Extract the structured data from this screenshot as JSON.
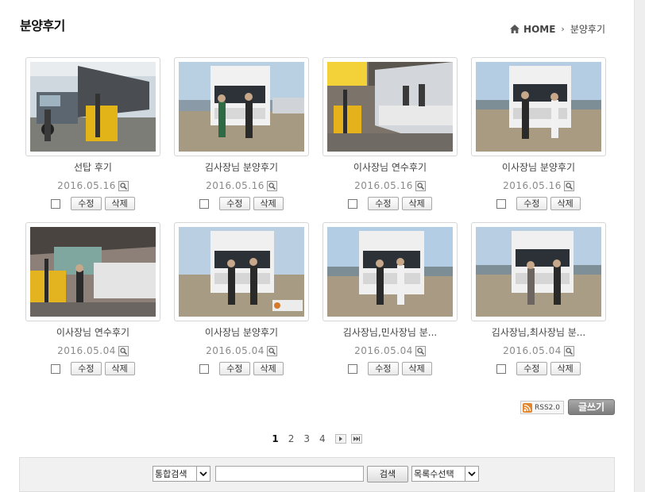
{
  "page": {
    "title": "분양후기"
  },
  "breadcrumb": {
    "home": "HOME",
    "current": "분양후기"
  },
  "posts": [
    {
      "title": "선탑 후기",
      "date": "2016.05.16",
      "edit": "수정",
      "delete": "삭제"
    },
    {
      "title": "김사장님 분양후기",
      "date": "2016.05.16",
      "edit": "수정",
      "delete": "삭제"
    },
    {
      "title": "이사장님 연수후기",
      "date": "2016.05.16",
      "edit": "수정",
      "delete": "삭제"
    },
    {
      "title": "이사장님 분양후기",
      "date": "2016.05.16",
      "edit": "수정",
      "delete": "삭제"
    },
    {
      "title": "이사장님 연수후기",
      "date": "2016.05.04",
      "edit": "수정",
      "delete": "삭제"
    },
    {
      "title": "이사장님 분양후기",
      "date": "2016.05.04",
      "edit": "수정",
      "delete": "삭제"
    },
    {
      "title": "김사장님,민사장님 분...",
      "date": "2016.05.04",
      "edit": "수정",
      "delete": "삭제"
    },
    {
      "title": "김사장님,최사장님 분...",
      "date": "2016.05.04",
      "edit": "수정",
      "delete": "삭제"
    }
  ],
  "actions": {
    "rss": "RSS2.0",
    "write": "글쓰기"
  },
  "pagination": {
    "pages": [
      "1",
      "2",
      "3",
      "4"
    ],
    "current": "1"
  },
  "search": {
    "scope": "통합검색",
    "query": "",
    "button": "검색",
    "list_count": "목록수선택"
  }
}
